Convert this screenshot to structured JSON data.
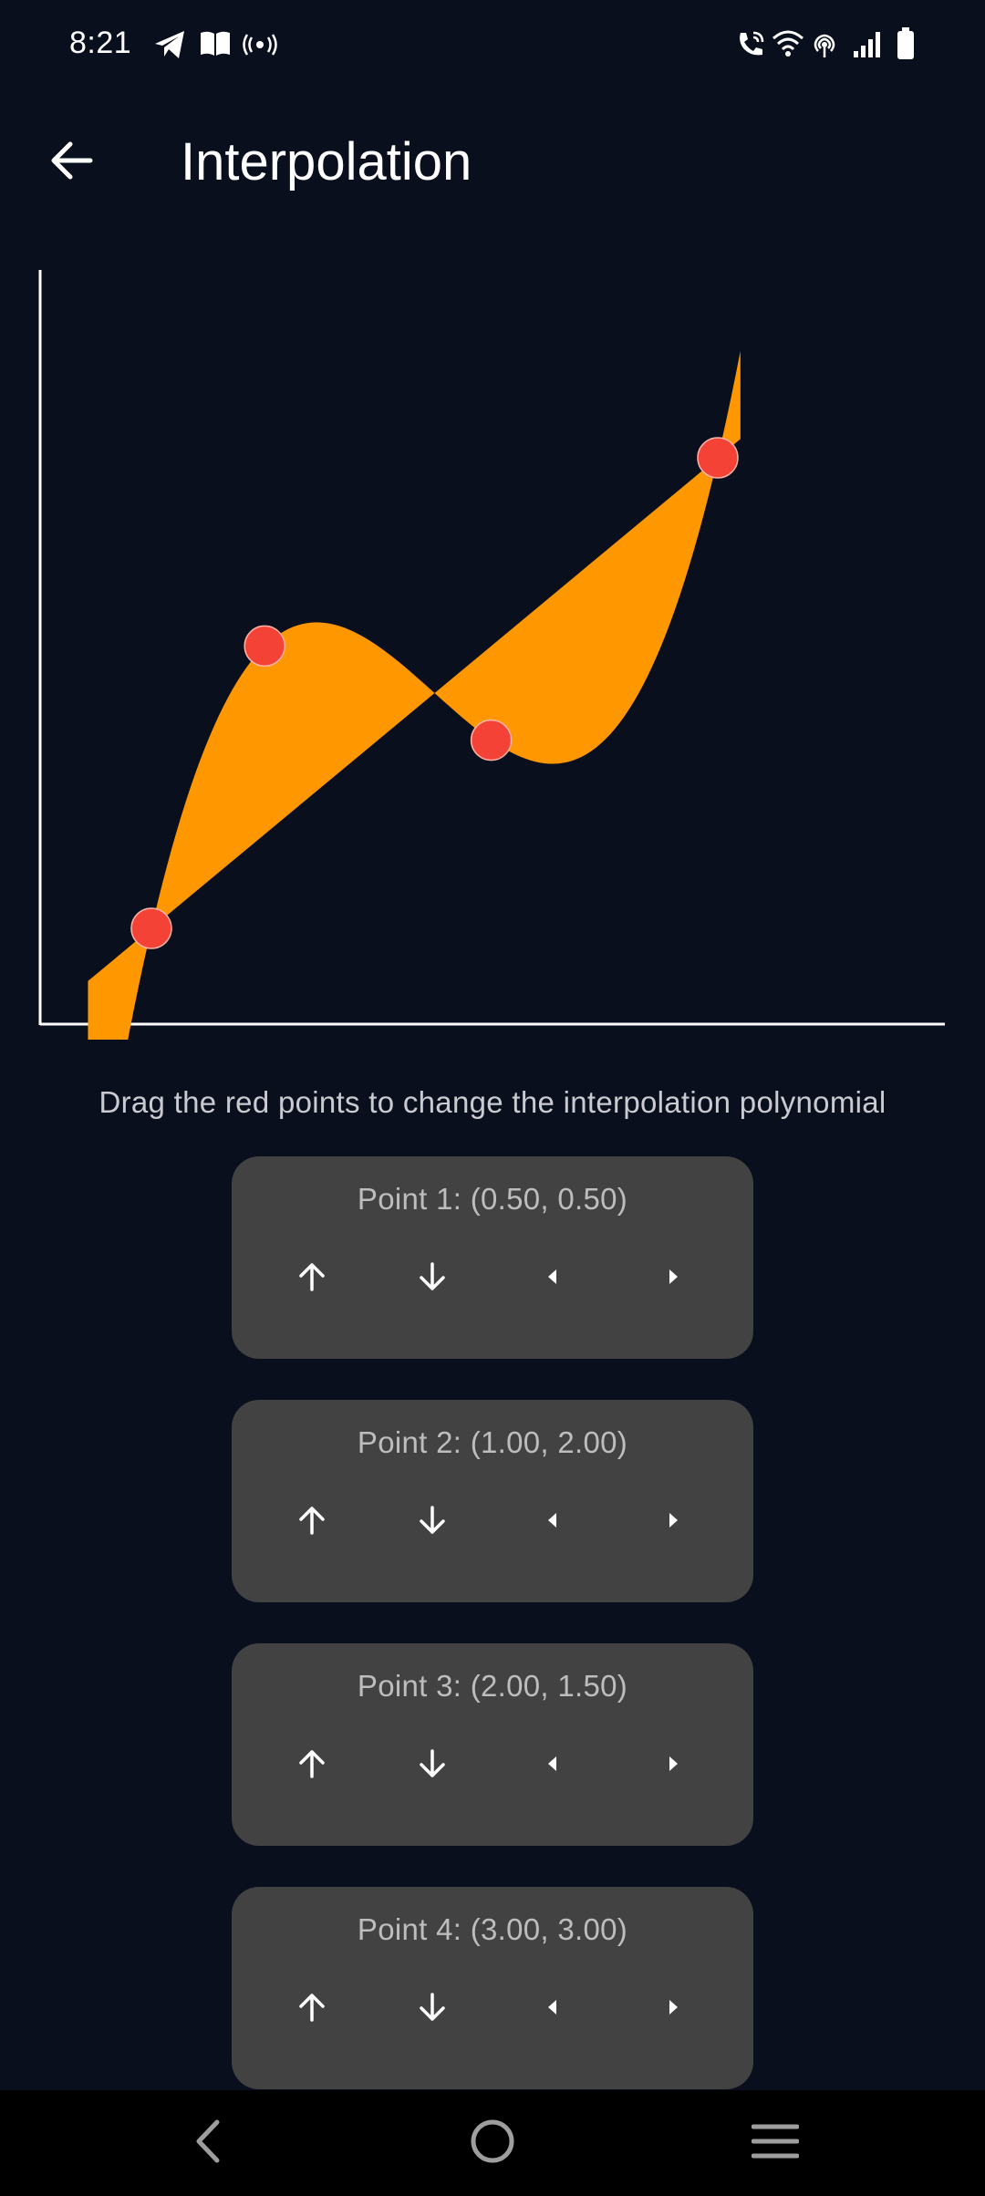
{
  "status_bar": {
    "time": "8:21",
    "left_icons": [
      "telegram-icon",
      "book-icon",
      "broadcast-icon"
    ],
    "right_icons": [
      "wifi-calling-icon",
      "wifi-icon",
      "hotspot-icon",
      "cellular-signal-icon",
      "battery-icon"
    ]
  },
  "app_bar": {
    "back_icon": "arrow-back-icon",
    "title": "Interpolation"
  },
  "chart_data": {
    "type": "area",
    "description_points": [
      {
        "x": 0.5,
        "y": 0.5
      },
      {
        "x": 1.0,
        "y": 2.0
      },
      {
        "x": 2.0,
        "y": 1.5
      },
      {
        "x": 3.0,
        "y": 3.0
      }
    ],
    "series": [
      {
        "kind": "interpolation-polynomial",
        "color": "#ff9800"
      },
      {
        "kind": "linear-reference",
        "color": "#ff9800"
      }
    ],
    "point_color": "#f44336",
    "fill_color": "#ff9800"
  },
  "instruction": "Drag the red points to change the interpolation polynomial",
  "points": [
    {
      "label": "Point 1: (0.50, 0.50)"
    },
    {
      "label": "Point 2: (1.00, 2.00)"
    },
    {
      "label": "Point 3: (2.00, 1.50)"
    },
    {
      "label": "Point 4: (3.00, 3.00)"
    }
  ],
  "card_controls": [
    "arrow-up-icon",
    "arrow-down-icon",
    "caret-left-icon",
    "caret-right-icon"
  ],
  "nav_bar": {
    "icons": [
      "nav-back-icon",
      "nav-home-icon",
      "nav-recents-icon"
    ]
  },
  "colors": {
    "background": "#0a0f1e",
    "card": "#424242",
    "accent": "#ff9800",
    "point": "#f44336"
  }
}
